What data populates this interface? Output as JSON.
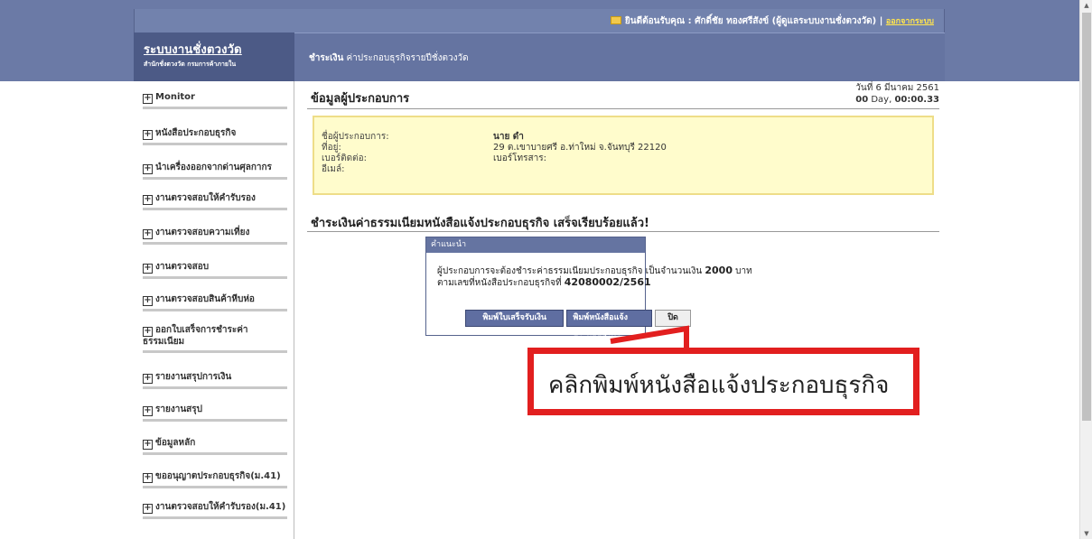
{
  "header": {
    "welcome": "ยินดีต้อนรับคุณ : ศักดิ์ชัย ทองศรีสังข์ (ผู้ดูแลระบบงานชั่งตวงวัด)",
    "separator": "|",
    "logout_label": "ออกจากระบบ"
  },
  "brand": {
    "title": "ระบบงานชั่งตวงวัด",
    "subtitle": "สำนักชั่งตวงวัด กรมการค้าภายใน"
  },
  "breadcrumb": {
    "bold": "ชำระเงิน",
    "rest": " ค่าประกอบธุรกิจรายปีชั่งตวงวัด"
  },
  "sidebar": {
    "items": [
      {
        "label": "Monitor"
      },
      {
        "label": "หนังสือประกอบธุรกิจ"
      },
      {
        "label": "นำเครื่องออกจากด่านศุลกากร"
      },
      {
        "label": "งานตรวจสอบให้คำรับรอง"
      },
      {
        "label": "งานตรวจสอบความเที่ยง"
      },
      {
        "label": "งานตรวจสอบ"
      },
      {
        "label": "งานตรวจสอบสินค้าหีบห่อ"
      },
      {
        "label": "ออกใบเสร็จการชำระค่าธรรมเนียม"
      },
      {
        "label": "รายงานสรุปการเงิน"
      },
      {
        "label": "รายงานสรุป"
      },
      {
        "label": "ข้อมูลหลัก"
      },
      {
        "label": "ขออนุญาตประกอบธุรกิจ(ม.41)"
      },
      {
        "label": "งานตรวจสอบให้คำรับรอง(ม.41)"
      }
    ]
  },
  "date": {
    "line1": "วันที่ 6 มีนาคม 2561",
    "day_num": "00",
    "day_word": " Day, ",
    "time": "00:00.33"
  },
  "section1": {
    "title": "ข้อมูลผู้ประกอบการ",
    "rows": [
      {
        "label": "ชื่อผู้ประกอบการ:",
        "value": "นาย ดำ"
      },
      {
        "label": "ที่อยู่:",
        "value": "29 ต.เขาบายศรี อ.ท่าใหม่ จ.จันทบุรี 22120"
      },
      {
        "label": "เบอร์ติดต่อ:",
        "value": "เบอร์โทรสาร:"
      },
      {
        "label": "อีเมล์:",
        "value": ""
      }
    ]
  },
  "section2": {
    "title": "ชำระเงินค่าธรรมเนียมหนังสือแจ้งประกอบธุรกิจ เสร็จเรียบร้อยแล้ว!"
  },
  "dialog": {
    "title": "คำแนะนำ",
    "line1_pre": "ผู้ประกอบการจะต้องชำระค่าธรรมเนียมประกอบธุรกิจ เป็นจำนวนเงิน ",
    "amount": "2000",
    "line1_post": " บาท",
    "line2_pre": "ตามเลขที่หนังสือประกอบธุรกิจที่ ",
    "doc_no": "42080002/2561",
    "btn_receipt": "พิมพ์ใบเสร็จรับเงิน",
    "btn_print_letter": "พิมพ์หนังสือแจ้งประกอบธุรกิจ",
    "btn_close": "ปิด"
  },
  "annotation": {
    "text": "คลิกพิมพ์หนังสือแจ้งประกอบธุรกิจ",
    "color": "#e21f1f"
  }
}
